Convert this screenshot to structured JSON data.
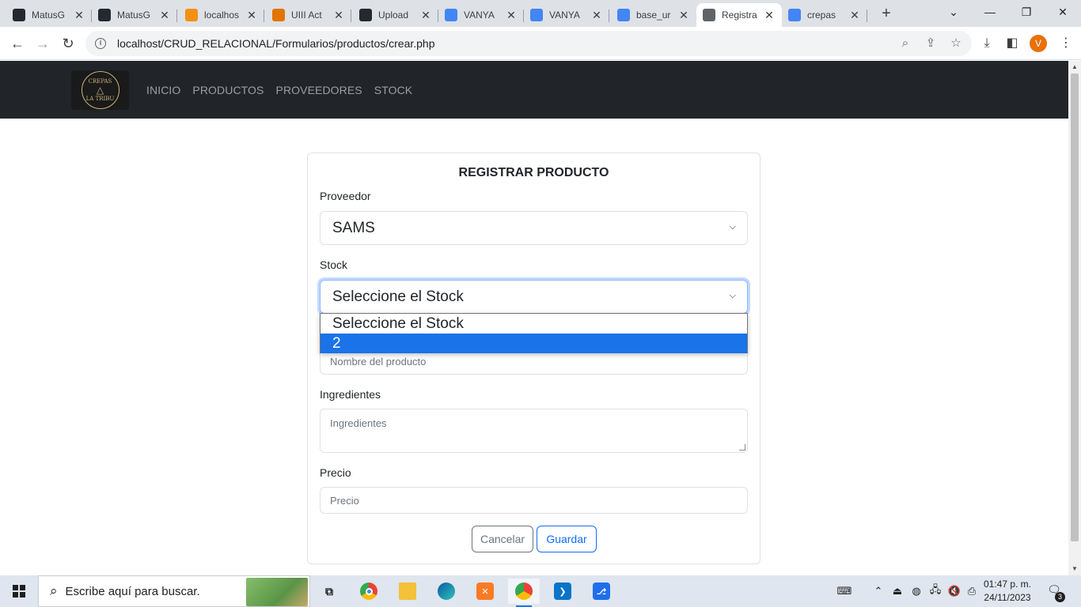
{
  "browser": {
    "tabs": [
      {
        "title": "MatusG",
        "icon": "github-icon",
        "color": "#24292f"
      },
      {
        "title": "MatusG",
        "icon": "github-icon",
        "color": "#24292f"
      },
      {
        "title": "localhos",
        "icon": "phpmyadmin-icon",
        "color": "#f29111"
      },
      {
        "title": "UIII Act",
        "icon": "classroom-icon",
        "color": "#e37400"
      },
      {
        "title": "Upload",
        "icon": "github-icon",
        "color": "#24292f"
      },
      {
        "title": "VANYA",
        "icon": "docs-icon",
        "color": "#4285f4"
      },
      {
        "title": "VANYA",
        "icon": "docs-icon",
        "color": "#4285f4"
      },
      {
        "title": "base_ur",
        "icon": "google-icon",
        "color": "#4285f4"
      },
      {
        "title": "Registra",
        "icon": "globe-icon",
        "color": "#5f6368"
      },
      {
        "title": "crepas",
        "icon": "google-icon",
        "color": "#4285f4"
      }
    ],
    "active_tab": 8,
    "url": "localhost/CRUD_RELACIONAL/Formularios/productos/crear.php",
    "profile_initial": "V"
  },
  "site": {
    "logo_text_top": "CREPAS",
    "logo_text_bottom": "LA TRIBU",
    "nav": [
      "INICIO",
      "PRODUCTOS",
      "PROVEEDORES",
      "STOCK"
    ]
  },
  "form": {
    "title": "REGISTRAR PRODUCTO",
    "proveedor_label": "Proveedor",
    "proveedor_value": "SAMS",
    "stock_label": "Stock",
    "stock_value": "Seleccione el Stock",
    "stock_options": [
      "Seleccione el Stock",
      "2"
    ],
    "stock_highlighted": 1,
    "nombre_placeholder": "Nombre del producto",
    "ingredientes_label": "Ingredientes",
    "ingredientes_placeholder": "Ingredientes",
    "precio_label": "Precio",
    "precio_placeholder": "Precio",
    "cancel_label": "Cancelar",
    "save_label": "Guardar"
  },
  "taskbar": {
    "search_placeholder": "Escribe aquí para buscar.",
    "apps": [
      "task-view-icon",
      "chrome-icon",
      "file-explorer-icon",
      "edge-icon",
      "xampp-icon",
      "chrome-profile-icon",
      "vscode-icon",
      "git-icon"
    ],
    "time": "01:47 p. m.",
    "date": "24/11/2023",
    "notifications": "3"
  }
}
